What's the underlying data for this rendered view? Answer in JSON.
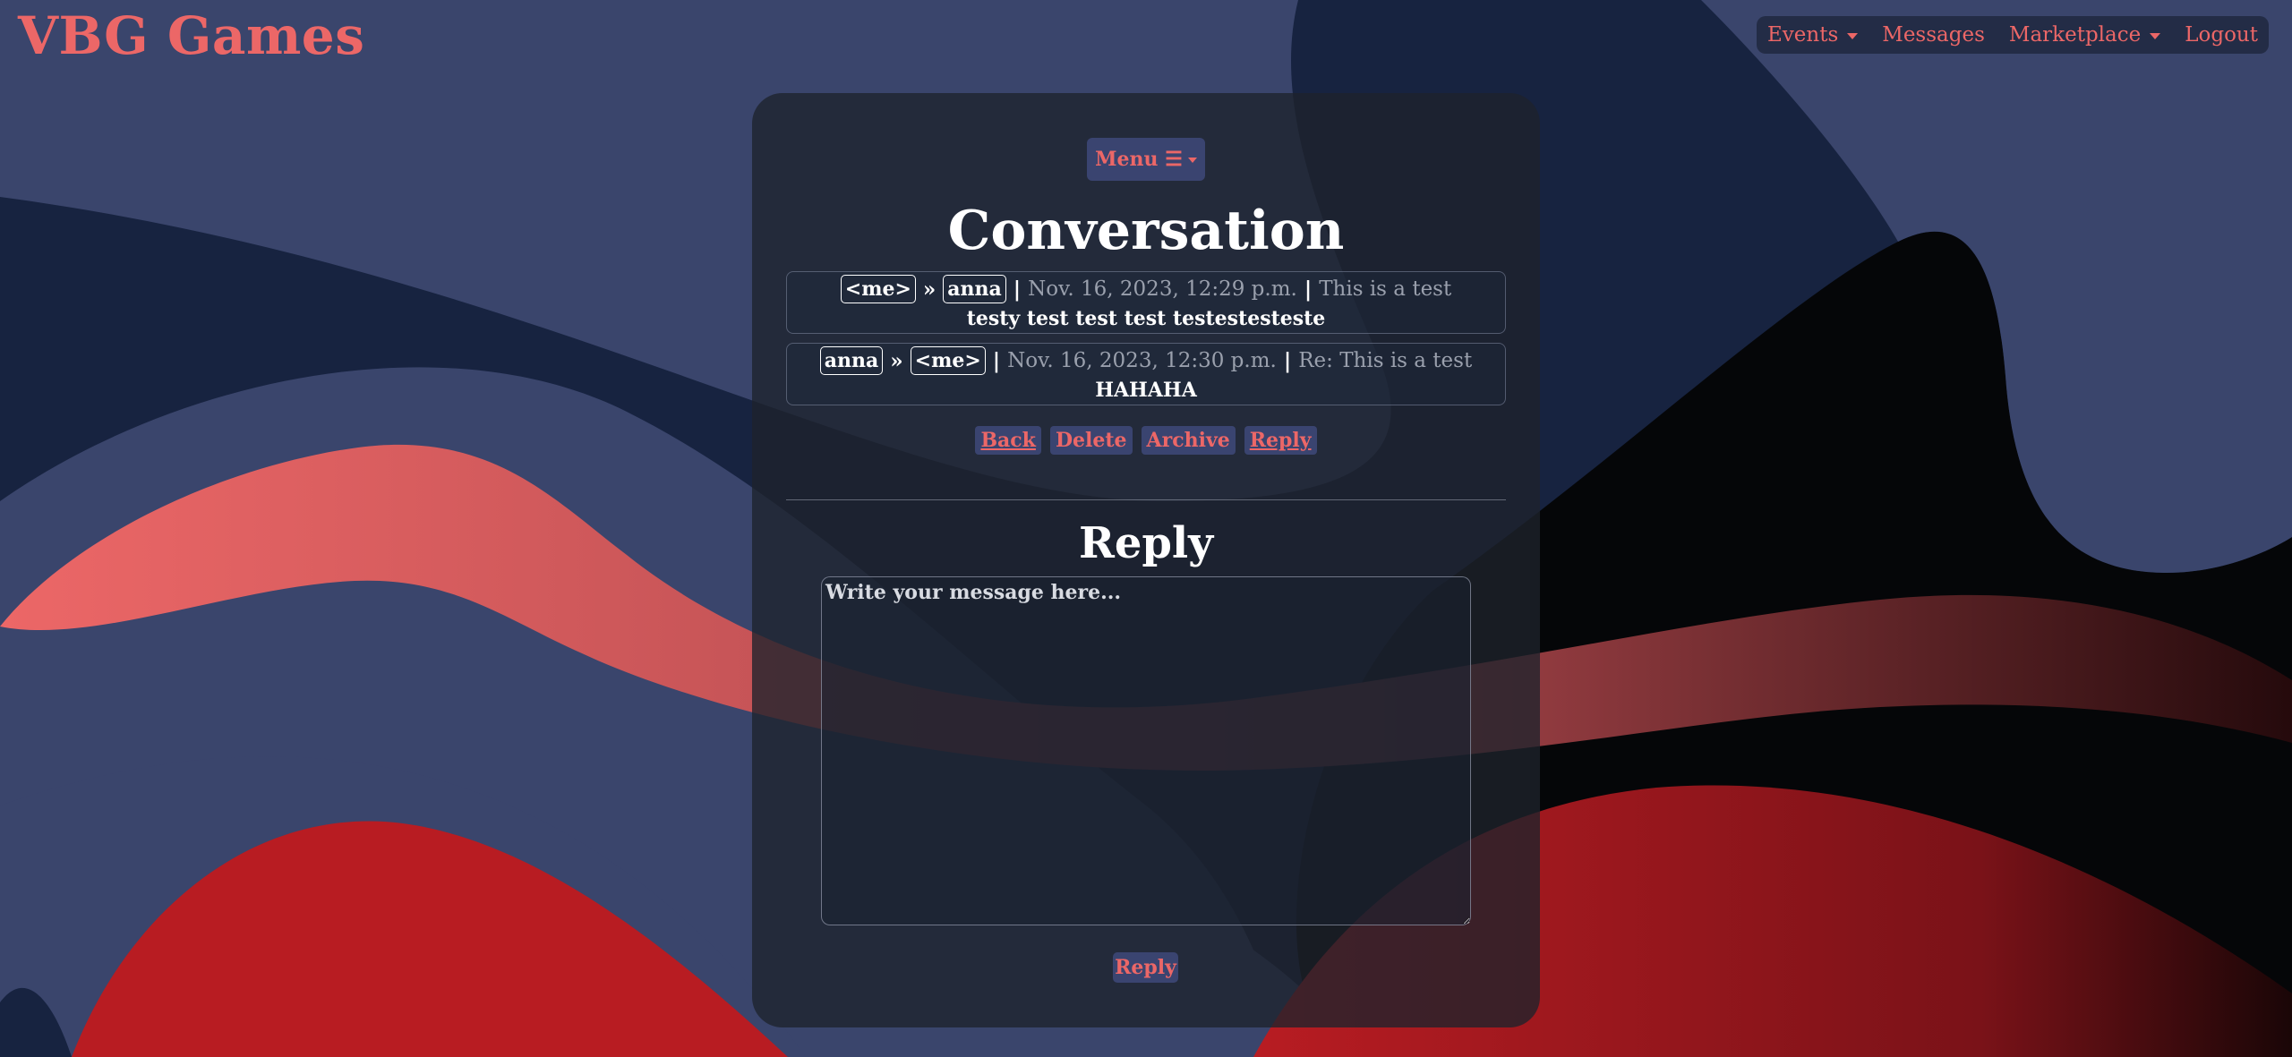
{
  "brand": "VBG Games",
  "nav": {
    "events": "Events",
    "messages": "Messages",
    "marketplace": "Marketplace",
    "logout": "Logout"
  },
  "menu_label": "Menu ☰",
  "page_title": "Conversation",
  "messages": [
    {
      "from": "<me>",
      "arrow": "»",
      "to": "anna",
      "date": "Nov. 16, 2023, 12:29 p.m.",
      "subject": "This is a test",
      "body": "testy test test test testestesteste"
    },
    {
      "from": "anna",
      "arrow": "»",
      "to": "<me>",
      "date": "Nov. 16, 2023, 12:30 p.m.",
      "subject": "Re: This is a test",
      "body": "HAHAHA"
    }
  ],
  "separator": "|",
  "actions": {
    "back": "Back",
    "delete": "Delete",
    "archive": "Archive",
    "reply": "Reply"
  },
  "reply_section": {
    "title": "Reply",
    "placeholder": "Write your message here...",
    "submit": "Reply"
  },
  "colors": {
    "accent": "#ec6767",
    "background": "#172340",
    "button": "#3a4470",
    "panel": "#1e222c"
  }
}
